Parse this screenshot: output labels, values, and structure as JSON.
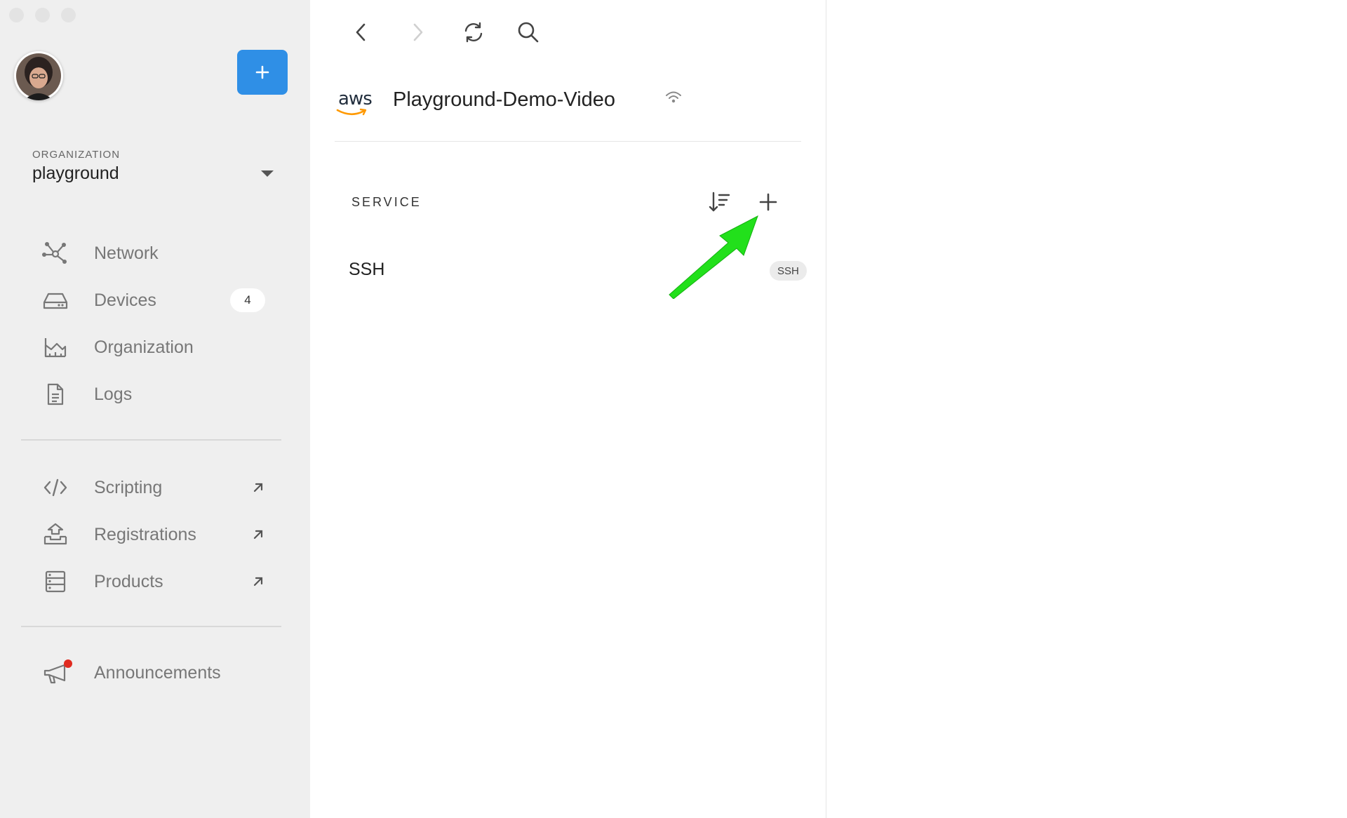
{
  "sidebar": {
    "add_label": "+",
    "organization": {
      "label": "ORGANIZATION",
      "value": "playground"
    },
    "nav": [
      {
        "label": "Network",
        "icon": "network-icon"
      },
      {
        "label": "Devices",
        "icon": "devices-icon",
        "badge": "4"
      },
      {
        "label": "Organization",
        "icon": "organization-icon"
      },
      {
        "label": "Logs",
        "icon": "logs-icon"
      }
    ],
    "links": [
      {
        "label": "Scripting",
        "icon": "code-icon"
      },
      {
        "label": "Registrations",
        "icon": "upload-icon"
      },
      {
        "label": "Products",
        "icon": "products-icon"
      }
    ],
    "announcements": {
      "label": "Announcements",
      "icon": "megaphone-icon",
      "has_notification": true
    }
  },
  "main": {
    "device": {
      "logo_text": "aws",
      "name": "Playground-Demo-Video"
    },
    "section": {
      "label": "SERVICE"
    },
    "services": [
      {
        "name": "SSH",
        "badge": "SSH"
      }
    ]
  },
  "colors": {
    "accent": "#2f8fe6",
    "annotation_arrow": "#22e01b",
    "notification": "#e02b20",
    "aws_orange": "#ff9900"
  }
}
